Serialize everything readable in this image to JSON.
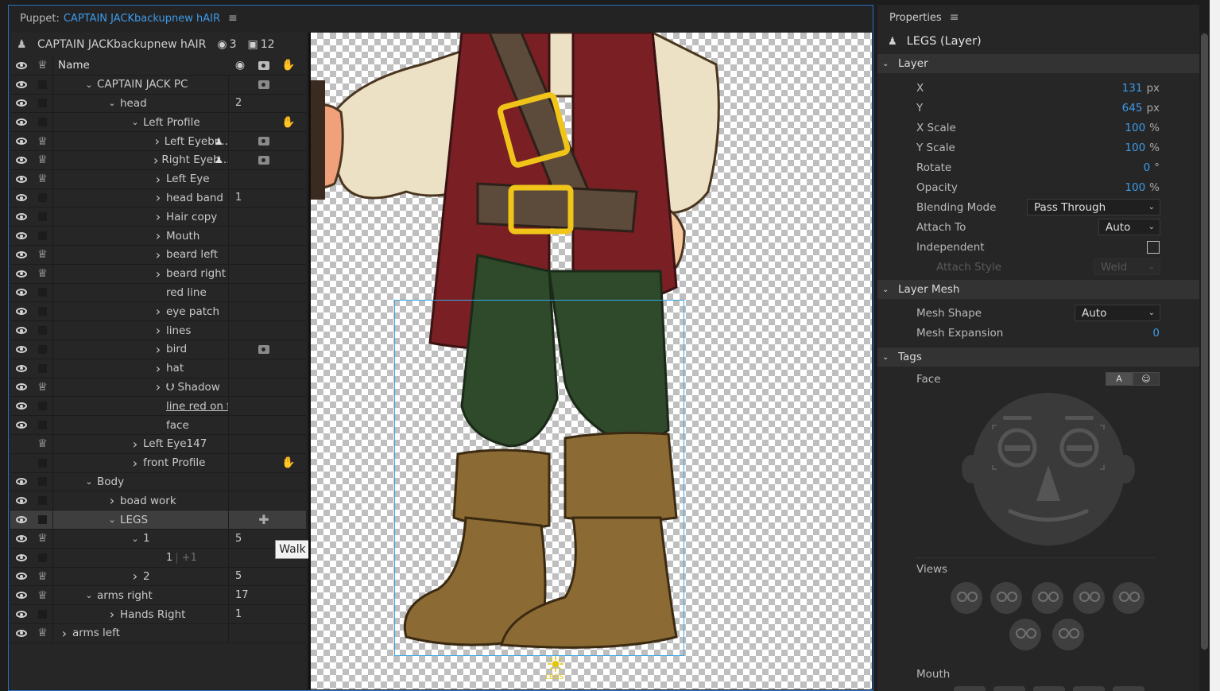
{
  "puppet_panel": {
    "label": "Puppet:",
    "name": "CAPTAIN JACKbackupnew hAIR",
    "menu_icon": "hamburger-menu-icon"
  },
  "tree": {
    "puppet_name": "CAPTAIN JACKbackupnew hAIR",
    "count_a": "3",
    "count_b": "12",
    "column_name": "Name",
    "rows": [
      {
        "label": "CAPTAIN JACK PC",
        "indent": 0,
        "expanded": true,
        "chevron": true,
        "eye": true,
        "crown": false,
        "num": "",
        "cam": true,
        "hand": false,
        "puppet": false
      },
      {
        "label": "head",
        "indent": 1,
        "expanded": true,
        "chevron": true,
        "eye": true,
        "crown": false,
        "num": "2",
        "cam": false,
        "hand": false,
        "puppet": false
      },
      {
        "label": "Left Profile",
        "indent": 2,
        "expanded": true,
        "chevron": true,
        "eye": true,
        "crown": false,
        "num": "",
        "cam": false,
        "hand": true,
        "puppet": false
      },
      {
        "label": "Left Eyebr...",
        "indent": 3,
        "expanded": false,
        "chevron": true,
        "eye": true,
        "crown": true,
        "num": "",
        "cam": true,
        "hand": false,
        "puppet": true
      },
      {
        "label": "Right Eyeb...",
        "indent": 3,
        "expanded": false,
        "chevron": true,
        "eye": true,
        "crown": true,
        "num": "",
        "cam": true,
        "hand": false,
        "puppet": true
      },
      {
        "label": "Left Eye",
        "indent": 3,
        "expanded": false,
        "chevron": true,
        "eye": true,
        "crown": true,
        "num": "",
        "cam": false,
        "hand": false,
        "puppet": false
      },
      {
        "label": "head band",
        "indent": 3,
        "expanded": false,
        "chevron": true,
        "eye": true,
        "crown": false,
        "num": "1",
        "cam": false,
        "hand": false,
        "puppet": false
      },
      {
        "label": "Hair copy",
        "indent": 3,
        "expanded": false,
        "chevron": true,
        "eye": true,
        "crown": false,
        "num": "",
        "cam": false,
        "hand": false,
        "puppet": false
      },
      {
        "label": "Mouth",
        "indent": 3,
        "expanded": false,
        "chevron": true,
        "eye": true,
        "crown": false,
        "num": "",
        "cam": false,
        "hand": false,
        "puppet": false
      },
      {
        "label": "beard left",
        "indent": 3,
        "expanded": false,
        "chevron": true,
        "eye": true,
        "crown": true,
        "num": "",
        "cam": false,
        "hand": false,
        "puppet": false
      },
      {
        "label": "beard right",
        "indent": 3,
        "expanded": false,
        "chevron": true,
        "eye": true,
        "crown": true,
        "num": "",
        "cam": false,
        "hand": false,
        "puppet": false
      },
      {
        "label": "red line",
        "indent": 3,
        "expanded": false,
        "chevron": false,
        "eye": true,
        "crown": false,
        "num": "",
        "cam": false,
        "hand": false,
        "puppet": false
      },
      {
        "label": "eye patch",
        "indent": 3,
        "expanded": false,
        "chevron": true,
        "eye": true,
        "crown": false,
        "num": "",
        "cam": false,
        "hand": false,
        "puppet": false
      },
      {
        "label": "lines",
        "indent": 3,
        "expanded": false,
        "chevron": true,
        "eye": true,
        "crown": false,
        "num": "",
        "cam": false,
        "hand": false,
        "puppet": false
      },
      {
        "label": "bird",
        "indent": 3,
        "expanded": false,
        "chevron": true,
        "eye": true,
        "crown": false,
        "num": "",
        "cam": true,
        "hand": false,
        "puppet": false
      },
      {
        "label": "hat",
        "indent": 3,
        "expanded": false,
        "chevron": true,
        "eye": true,
        "crown": false,
        "num": "",
        "cam": false,
        "hand": false,
        "puppet": false
      },
      {
        "label": "⮋ Shadow",
        "indent": 3,
        "expanded": false,
        "chevron": true,
        "eye": true,
        "crown": true,
        "num": "",
        "cam": false,
        "hand": false,
        "puppet": false
      },
      {
        "label": "line red on face",
        "indent": 3,
        "expanded": false,
        "chevron": false,
        "eye": true,
        "crown": false,
        "num": "",
        "cam": false,
        "hand": false,
        "puppet": false,
        "underline": true
      },
      {
        "label": "face",
        "indent": 3,
        "expanded": false,
        "chevron": false,
        "eye": true,
        "crown": false,
        "num": "",
        "cam": false,
        "hand": false,
        "puppet": false
      },
      {
        "label": "Left Eye147",
        "indent": 2,
        "expanded": false,
        "chevron": true,
        "eye": false,
        "crown": true,
        "num": "",
        "cam": false,
        "hand": false,
        "puppet": false
      },
      {
        "label": "front Profile",
        "indent": 2,
        "expanded": false,
        "chevron": true,
        "eye": false,
        "crown": false,
        "num": "",
        "cam": false,
        "hand": true,
        "puppet": false
      },
      {
        "label": "Body",
        "indent": 0,
        "expanded": true,
        "chevron": true,
        "eye": true,
        "crown": false,
        "num": "",
        "cam": false,
        "hand": false,
        "puppet": false
      },
      {
        "label": "boad work",
        "indent": 1,
        "expanded": false,
        "chevron": true,
        "eye": true,
        "crown": false,
        "num": "",
        "cam": false,
        "hand": false,
        "puppet": false
      },
      {
        "label": "LEGS",
        "indent": 1,
        "expanded": true,
        "chevron": true,
        "eye": true,
        "crown": false,
        "num": "",
        "cam": false,
        "hand": false,
        "puppet": false,
        "selected": true,
        "plus": true
      },
      {
        "label": "1",
        "indent": 2,
        "expanded": true,
        "chevron": true,
        "eye": true,
        "crown": true,
        "num": "5",
        "cam": false,
        "hand": false,
        "puppet": false
      },
      {
        "label": "1",
        "indent": 3,
        "expanded": false,
        "chevron": false,
        "eye": true,
        "crown": false,
        "num": "",
        "cam": false,
        "hand": false,
        "puppet": false,
        "suffix": "+1"
      },
      {
        "label": "2",
        "indent": 2,
        "expanded": false,
        "chevron": true,
        "eye": true,
        "crown": true,
        "num": "5",
        "cam": false,
        "hand": false,
        "puppet": false
      },
      {
        "label": "arms right",
        "indent": 0,
        "expanded": true,
        "chevron": true,
        "eye": true,
        "crown": true,
        "num": "17",
        "cam": false,
        "hand": false,
        "puppet": false
      },
      {
        "label": "Hands Right",
        "indent": 1,
        "expanded": false,
        "chevron": true,
        "eye": true,
        "crown": false,
        "num": "1",
        "cam": false,
        "hand": false,
        "puppet": false
      },
      {
        "label": "arms left",
        "indent": -1,
        "expanded": false,
        "chevron": true,
        "eye": true,
        "crown": true,
        "num": "",
        "cam": false,
        "hand": false,
        "puppet": false
      }
    ],
    "tooltip": "Walk"
  },
  "canvas": {
    "origin_label": "LEGS"
  },
  "properties": {
    "header": "Properties",
    "menu_icon": "hamburger-menu-icon",
    "title": "LEGS (Layer)",
    "sections": {
      "layer": "Layer",
      "mesh": "Layer Mesh",
      "tags": "Tags"
    },
    "x": {
      "label": "X",
      "value": "131",
      "unit": "px"
    },
    "y": {
      "label": "Y",
      "value": "645",
      "unit": "px"
    },
    "xscale": {
      "label": "X Scale",
      "value": "100",
      "unit": "%"
    },
    "yscale": {
      "label": "Y Scale",
      "value": "100",
      "unit": "%"
    },
    "rotate": {
      "label": "Rotate",
      "value": "0",
      "unit": "°"
    },
    "opacity": {
      "label": "Opacity",
      "value": "100",
      "unit": "%"
    },
    "blending": {
      "label": "Blending Mode",
      "value": "Pass Through"
    },
    "attach": {
      "label": "Attach To",
      "value": "Auto"
    },
    "independent": {
      "label": "Independent",
      "checked": false
    },
    "attach_style": {
      "label": "Attach Style",
      "value": "Weld"
    },
    "mesh_shape": {
      "label": "Mesh Shape",
      "value": "Auto"
    },
    "mesh_expansion": {
      "label": "Mesh Expansion",
      "value": "0"
    },
    "face": {
      "label": "Face",
      "toggle_a": "A",
      "toggle_b": "☺"
    },
    "views_label": "Views",
    "mouth_label": "Mouth"
  }
}
